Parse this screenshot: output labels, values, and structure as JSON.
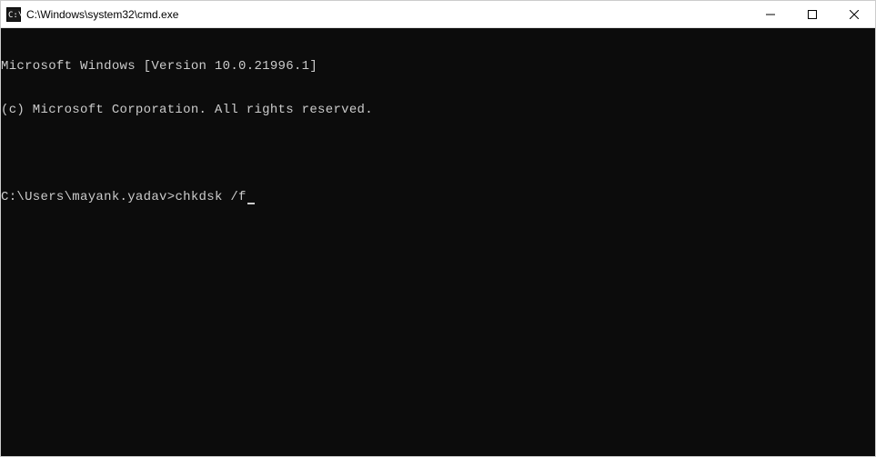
{
  "titlebar": {
    "title": "C:\\Windows\\system32\\cmd.exe"
  },
  "terminal": {
    "line1": "Microsoft Windows [Version 10.0.21996.1]",
    "line2": "(c) Microsoft Corporation. All rights reserved.",
    "blank": "",
    "prompt": "C:\\Users\\mayank.yadav>",
    "command": "chkdsk /f"
  }
}
